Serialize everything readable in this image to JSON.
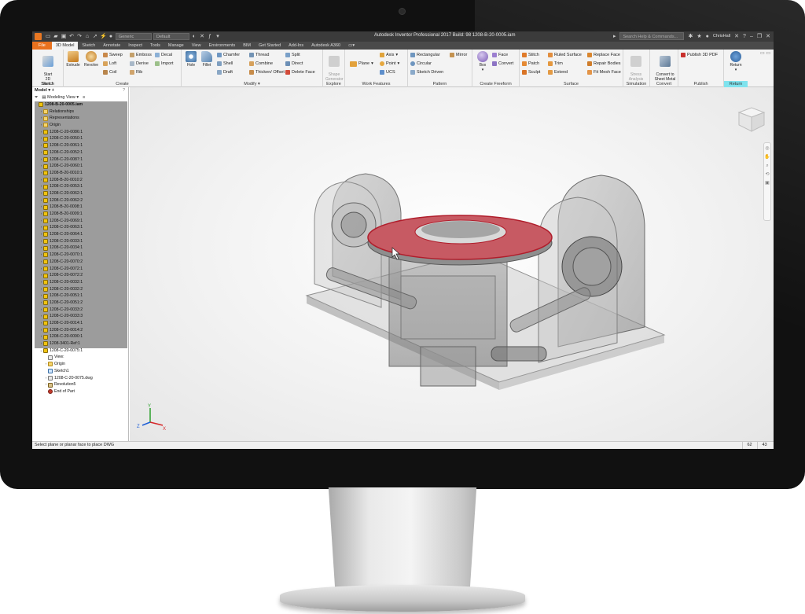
{
  "window": {
    "title": "Autodesk Inventor Professional 2017 Build: 98    1208-B-20-0005.iam",
    "material_select": "Generic",
    "appearance_select": "Default",
    "help_search_placeholder": "Search Help & Commands...",
    "user": "ChrisHall"
  },
  "tabs": [
    {
      "label": "File",
      "kind": "file"
    },
    {
      "label": "3D Model",
      "kind": "active"
    },
    {
      "label": "Sketch"
    },
    {
      "label": "Annotate"
    },
    {
      "label": "Inspect"
    },
    {
      "label": "Tools"
    },
    {
      "label": "Manage"
    },
    {
      "label": "View"
    },
    {
      "label": "Environments"
    },
    {
      "label": "BIM"
    },
    {
      "label": "Get Started"
    },
    {
      "label": "Add-Ins"
    },
    {
      "label": "Autodesk A360"
    }
  ],
  "ribbon": {
    "sketch": {
      "title": "Sketch",
      "start": "Start\n2D Sketch"
    },
    "create": {
      "title": "Create",
      "extrude": "Extrude",
      "revolve": "Revolve",
      "sweep": "Sweep",
      "loft": "Loft",
      "coil": "Coil",
      "emboss": "Emboss",
      "derive": "Derive",
      "rib": "Rib",
      "decal": "Decal",
      "import": "Import"
    },
    "modify": {
      "title": "Modify",
      "hole": "Hole",
      "fillet": "Fillet",
      "chamfer": "Chamfer",
      "shell": "Shell",
      "draft": "Draft",
      "thread": "Thread",
      "combine": "Combine",
      "thicken": "Thicken/ Offset",
      "split": "Split",
      "direct": "Direct",
      "delete_face": "Delete Face"
    },
    "explore": {
      "title": "Explore",
      "shape_generator": "Shape\nGenerator"
    },
    "work_features": {
      "title": "Work Features",
      "plane": "Plane",
      "axis": "Axis",
      "point": "Point",
      "ucs": "UCS"
    },
    "pattern": {
      "title": "Pattern",
      "rectangular": "Rectangular",
      "circular": "Circular",
      "sketch_driven": "Sketch Driven",
      "mirror": "Mirror"
    },
    "freeform": {
      "title": "Create Freeform",
      "box": "Box",
      "face": "Face",
      "convert": "Convert"
    },
    "surface": {
      "title": "Surface",
      "stitch": "Stitch",
      "patch": "Patch",
      "sculpt": "Sculpt",
      "ruled_surface": "Ruled Surface",
      "trim": "Trim",
      "extend": "Extend",
      "replace_face": "Replace Face",
      "repair_bodies": "Repair Bodies",
      "fit_mesh_face": "Fit Mesh Face"
    },
    "simulation": {
      "title": "Simulation",
      "stress_analysis": "Stress\nAnalysis"
    },
    "convert": {
      "title": "Convert",
      "convert_sheet_metal": "Convert to\nSheet Metal"
    },
    "publish": {
      "title": "Publish",
      "publish_3d_pdf": "Publish 3D PDF"
    },
    "return": {
      "title": "Return",
      "return": "Return"
    }
  },
  "browser": {
    "title": "Model",
    "view_mode": "Modeling View",
    "nodes": [
      {
        "label": "1208-B-20-0005.iam",
        "icon": "asm",
        "indent": 0,
        "arrow": "",
        "bold": true
      },
      {
        "label": "Relationships",
        "icon": "fold",
        "indent": 1,
        "arrow": "›"
      },
      {
        "label": "Representations",
        "icon": "fold",
        "indent": 1,
        "arrow": "›"
      },
      {
        "label": "Origin",
        "icon": "fold",
        "indent": 1,
        "arrow": "›"
      },
      {
        "label": "1208-C-20-0086:1",
        "icon": "part",
        "indent": 1,
        "arrow": "›"
      },
      {
        "label": "1208-C-20-0050:1",
        "icon": "part",
        "indent": 1,
        "arrow": "›"
      },
      {
        "label": "1208-C-20-0061:1",
        "icon": "part",
        "indent": 1,
        "arrow": "›"
      },
      {
        "label": "1208-C-20-0052:1",
        "icon": "part",
        "indent": 1,
        "arrow": "›"
      },
      {
        "label": "1208-C-20-0087:1",
        "icon": "part",
        "indent": 1,
        "arrow": "›"
      },
      {
        "label": "1208-C-20-0060:1",
        "icon": "part",
        "indent": 1,
        "arrow": "›"
      },
      {
        "label": "1208-B-20-0010:1",
        "icon": "part",
        "indent": 1,
        "arrow": "›"
      },
      {
        "label": "1208-B-20-0010:2",
        "icon": "part",
        "indent": 1,
        "arrow": "›"
      },
      {
        "label": "1208-C-20-0053:1",
        "icon": "part",
        "indent": 1,
        "arrow": "›"
      },
      {
        "label": "1208-C-20-0062:1",
        "icon": "part",
        "indent": 1,
        "arrow": "›"
      },
      {
        "label": "1208-C-20-0062:2",
        "icon": "part",
        "indent": 1,
        "arrow": "›"
      },
      {
        "label": "1208-B-20-0008:1",
        "icon": "part",
        "indent": 1,
        "arrow": "›"
      },
      {
        "label": "1208-B-20-0009:1",
        "icon": "part",
        "indent": 1,
        "arrow": "›"
      },
      {
        "label": "1208-C-20-0069:1",
        "icon": "part",
        "indent": 1,
        "arrow": "›"
      },
      {
        "label": "1208-C-20-0063:1",
        "icon": "part",
        "indent": 1,
        "arrow": "›"
      },
      {
        "label": "1208-C-20-0064:1",
        "icon": "part",
        "indent": 1,
        "arrow": "›"
      },
      {
        "label": "1208-C-20-0033:1",
        "icon": "part",
        "indent": 1,
        "arrow": "›"
      },
      {
        "label": "1208-C-20-0034:1",
        "icon": "part",
        "indent": 1,
        "arrow": "›"
      },
      {
        "label": "1208-C-20-0070:1",
        "icon": "part",
        "indent": 1,
        "arrow": "›"
      },
      {
        "label": "1208-C-20-0070:2",
        "icon": "part",
        "indent": 1,
        "arrow": "›"
      },
      {
        "label": "1208-C-20-0072:1",
        "icon": "part",
        "indent": 1,
        "arrow": "›"
      },
      {
        "label": "1208-C-20-0072:2",
        "icon": "part",
        "indent": 1,
        "arrow": "›"
      },
      {
        "label": "1208-C-20-0032:1",
        "icon": "part",
        "indent": 1,
        "arrow": "›"
      },
      {
        "label": "1208-C-20-0032:2",
        "icon": "part",
        "indent": 1,
        "arrow": "›"
      },
      {
        "label": "1208-C-20-0051:1",
        "icon": "part",
        "indent": 1,
        "arrow": "›"
      },
      {
        "label": "1208-C-20-0051:2",
        "icon": "part",
        "indent": 1,
        "arrow": "›"
      },
      {
        "label": "1208-C-20-0033:2",
        "icon": "part",
        "indent": 1,
        "arrow": "›"
      },
      {
        "label": "1208-C-20-0033:3",
        "icon": "part",
        "indent": 1,
        "arrow": "›"
      },
      {
        "label": "1208-C-20-0014:1",
        "icon": "part",
        "indent": 1,
        "arrow": "›"
      },
      {
        "label": "1208-C-20-0014:2",
        "icon": "part",
        "indent": 1,
        "arrow": "›"
      },
      {
        "label": "1208-C-20-0090:1",
        "icon": "part",
        "indent": 1,
        "arrow": "›"
      },
      {
        "label": "1208-3401-Ref:1",
        "icon": "part",
        "indent": 1,
        "arrow": "›"
      },
      {
        "label": "1208-C-20-0075:1",
        "icon": "part",
        "indent": 1,
        "arrow": "⌄"
      },
      {
        "label": "View:",
        "icon": "doc",
        "indent": 2,
        "arrow": ""
      },
      {
        "label": "Origin",
        "icon": "fold",
        "indent": 2,
        "arrow": "›"
      },
      {
        "label": "Sketch1",
        "icon": "sk",
        "indent": 2,
        "arrow": ""
      },
      {
        "label": "1208-C-20-0075.dwg",
        "icon": "doc",
        "indent": 2,
        "arrow": "›"
      },
      {
        "label": "Revolution5",
        "icon": "rev",
        "indent": 2,
        "arrow": "›"
      },
      {
        "label": "End of Part",
        "icon": "end",
        "indent": 2,
        "arrow": ""
      }
    ]
  },
  "triad": {
    "x": "X",
    "y": "Y",
    "z": "Z"
  },
  "status": {
    "message": "Select plane or planar face to place DWG",
    "num1": "62",
    "num2": "43"
  },
  "colors": {
    "file_tab": "#e8711e",
    "highlight_face": "#c9565f",
    "return_panel": "#7fe3ee"
  }
}
